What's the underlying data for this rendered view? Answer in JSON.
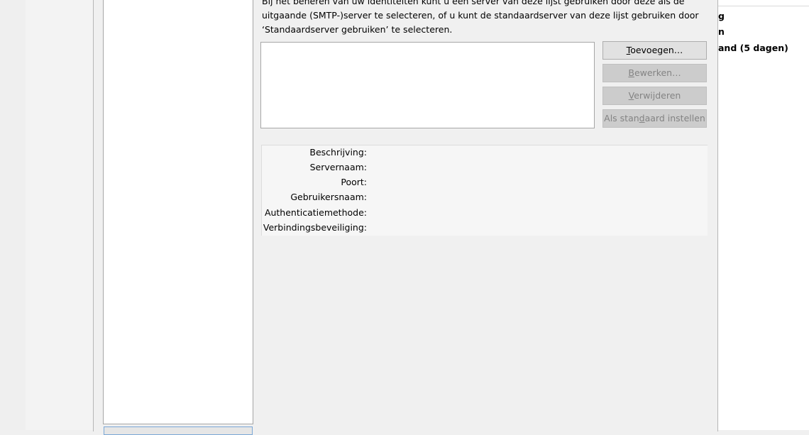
{
  "background": {
    "right_items": [
      "g",
      "n",
      "and (5 dagen)"
    ]
  },
  "smtp": {
    "description": "Bij het beheren van uw identiteiten kunt u een server van deze lijst gebruiken door deze als de uitgaande (SMTP-)server te selecteren, of u kunt de standaardserver van deze lijst gebruiken door ‘Standaardserver gebruiken’ te selecteren.",
    "buttons": {
      "add": {
        "prefix": "",
        "accel": "T",
        "rest": "oevoegen…"
      },
      "edit": {
        "prefix": "",
        "accel": "B",
        "rest": "ewerken…"
      },
      "remove": {
        "prefix": "",
        "accel": "V",
        "rest": "erwijderen"
      },
      "set_default": {
        "prefix": "Als stan",
        "accel": "d",
        "rest": "aard instellen"
      }
    },
    "details": {
      "description_label": "Beschrijving:",
      "server_name_label": "Servernaam:",
      "port_label": "Poort:",
      "username_label": "Gebruikersnaam:",
      "auth_method_label": "Authenticatiemethode:",
      "connection_security_label": "Verbindingsbeveiliging:"
    }
  }
}
